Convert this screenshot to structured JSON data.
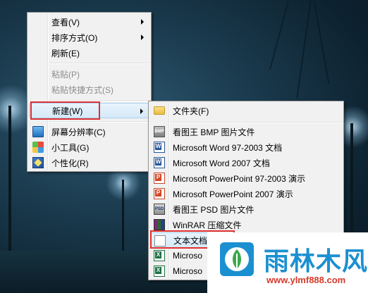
{
  "context_menu": {
    "items": [
      {
        "label": "查看(V)",
        "submenu": true,
        "disabled": false
      },
      {
        "label": "排序方式(O)",
        "submenu": true,
        "disabled": false
      },
      {
        "label": "刷新(E)",
        "submenu": false,
        "disabled": false
      },
      {
        "label": "粘贴(P)",
        "submenu": false,
        "disabled": true
      },
      {
        "label": "粘贴快捷方式(S)",
        "submenu": false,
        "disabled": true
      },
      {
        "label": "新建(W)",
        "submenu": true,
        "disabled": false,
        "highlighted": true
      },
      {
        "label": "屏幕分辨率(C)",
        "icon": "screen-resolution-icon"
      },
      {
        "label": "小工具(G)",
        "icon": "gadgets-icon"
      },
      {
        "label": "个性化(R)",
        "icon": "personalize-icon"
      }
    ]
  },
  "new_submenu": {
    "items": [
      {
        "label": "文件夹(F)",
        "icon": "folder-icon"
      },
      {
        "label": "看图王 BMP 图片文件",
        "icon": "bmp-file-icon"
      },
      {
        "label": "Microsoft Word 97-2003 文档",
        "icon": "word-doc-icon"
      },
      {
        "label": "Microsoft Word 2007 文档",
        "icon": "word-doc-icon"
      },
      {
        "label": "Microsoft PowerPoint 97-2003 演示",
        "icon": "powerpoint-icon"
      },
      {
        "label": "Microsoft PowerPoint 2007 演示",
        "icon": "powerpoint-icon"
      },
      {
        "label": "看图王 PSD 图片文件",
        "icon": "psd-file-icon"
      },
      {
        "label": "WinRAR 压缩文件",
        "icon": "winrar-icon"
      },
      {
        "label": "文本文档",
        "icon": "text-document-icon",
        "highlighted": true
      },
      {
        "label": "Microso",
        "icon": "excel-icon"
      },
      {
        "label": "Microso",
        "icon": "excel-icon"
      }
    ]
  },
  "watermark": {
    "title": "雨林木风",
    "url": "www.ylmf888.com"
  },
  "colors": {
    "highlight_border": "#e03030",
    "watermark_blue": "#1b90d0",
    "watermark_red": "#d43a2a"
  }
}
